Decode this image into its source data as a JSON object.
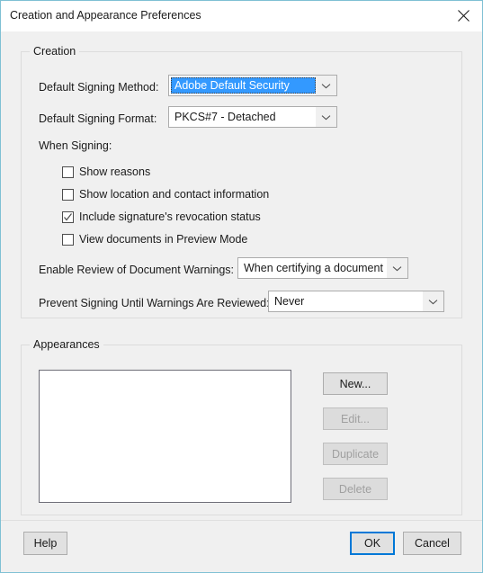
{
  "window": {
    "title": "Creation and Appearance Preferences",
    "close_icon": "close-icon",
    "accent_color": "#0078d7",
    "border_color": "#7fc0d4",
    "highlight_color": "#3399ff"
  },
  "creation": {
    "group_title": "Creation",
    "signing_method": {
      "label": "Default Signing Method:",
      "value": "Adobe Default Security",
      "focused": true
    },
    "signing_format": {
      "label": "Default Signing Format:",
      "value": "PKCS#7 - Detached",
      "focused": false
    },
    "when_signing_label": "When Signing:",
    "checkboxes": [
      {
        "label": "Show reasons",
        "checked": false
      },
      {
        "label": "Show location and contact information",
        "checked": false
      },
      {
        "label": "Include signature's revocation status",
        "checked": true
      },
      {
        "label": "View documents in Preview Mode",
        "checked": false
      }
    ],
    "enable_review": {
      "label": "Enable Review of Document Warnings:",
      "value": "When certifying a document"
    },
    "prevent_signing": {
      "label": "Prevent Signing Until Warnings Are Reviewed:",
      "value": "Never"
    }
  },
  "appearances": {
    "group_title": "Appearances",
    "list_items": [],
    "buttons": [
      {
        "label": "New...",
        "enabled": true
      },
      {
        "label": "Edit...",
        "enabled": false
      },
      {
        "label": "Duplicate",
        "enabled": false
      },
      {
        "label": "Delete",
        "enabled": false
      }
    ]
  },
  "footer": {
    "help": "Help",
    "ok": "OK",
    "cancel": "Cancel"
  }
}
